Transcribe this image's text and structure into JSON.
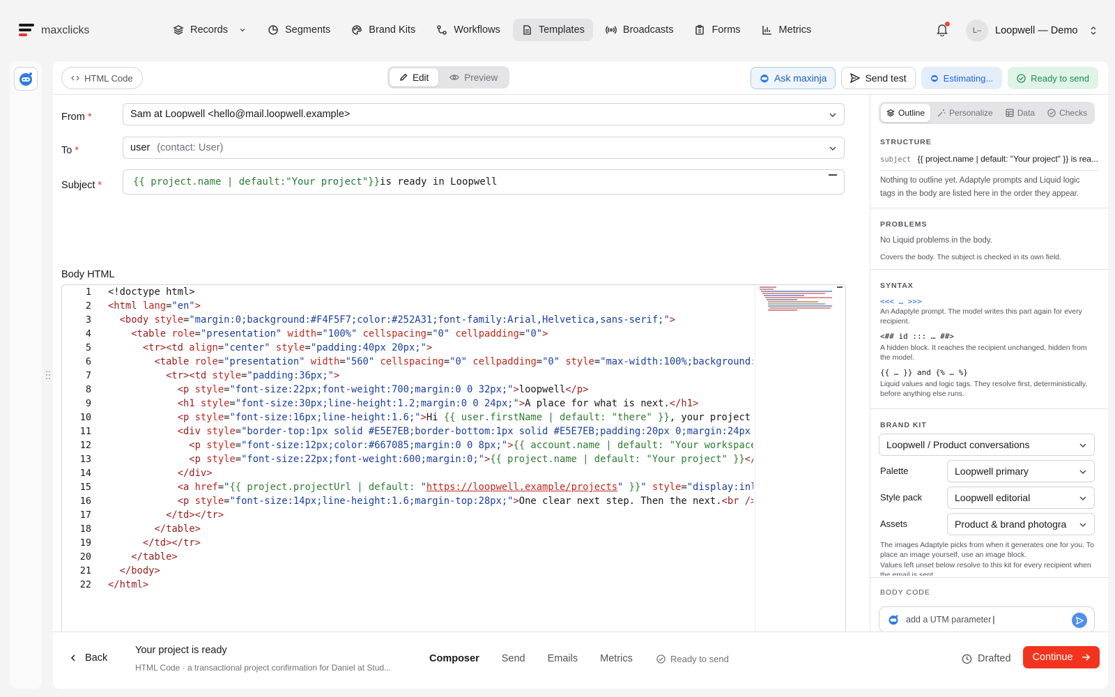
{
  "brand": {
    "name": "maxclicks",
    "accent": "#e8372a"
  },
  "nav": [
    {
      "label": "Records",
      "icon": "layers-icon",
      "dropdown": true,
      "active": false
    },
    {
      "label": "Segments",
      "icon": "pie-icon",
      "active": false
    },
    {
      "label": "Brand Kits",
      "icon": "palette-icon",
      "active": false
    },
    {
      "label": "Workflows",
      "icon": "workflow-icon",
      "active": false
    },
    {
      "label": "Templates",
      "icon": "document-icon",
      "active": true
    },
    {
      "label": "Broadcasts",
      "icon": "broadcast-icon",
      "active": false
    },
    {
      "label": "Forms",
      "icon": "clipboard-icon",
      "active": false
    },
    {
      "label": "Metrics",
      "icon": "bar-chart-icon",
      "active": false
    }
  ],
  "account": {
    "initials": "L–",
    "name": "Loopwell — Demo"
  },
  "toolbar": {
    "html_code_label": "HTML Code",
    "edit_label": "Edit",
    "preview_label": "Preview",
    "ask_label": "Ask maxinja",
    "send_test_label": "Send test",
    "estimating_label": "Estimating...",
    "ready_label": "Ready to send"
  },
  "form": {
    "from_label": "From",
    "from_value": "Sam at Loopwell <hello@mail.loopwell.example>",
    "to_label": "To",
    "to_value": "user",
    "to_hint": "(contact: User)",
    "subject_label": "Subject",
    "subject_liquid": "{{ project.name | default: ",
    "subject_string": "\"Your project\"",
    "subject_close": " }}",
    "subject_rest": " is ready in Loopwell",
    "body_label": "Body HTML"
  },
  "code_lines": [
    "1",
    "2",
    "3",
    "4",
    "5",
    "6",
    "7",
    "8",
    "9",
    "10",
    "11",
    "12",
    "13",
    "14",
    "15",
    "16",
    "17",
    "18",
    "19",
    "20",
    "21",
    "22"
  ],
  "right_panel": {
    "tabs": [
      "Outline",
      "Personalize",
      "Data",
      "Checks"
    ],
    "structure_title": "STRUCTURE",
    "structure_key": "subject",
    "structure_value": "{{ project.name | default: \"Your project\" }} is rea...",
    "structure_note": "Nothing to outline yet. Adaptyle prompts and Liquid logic tags in the body are listed here in the order they appear.",
    "problems_title": "PROBLEMS",
    "problems_text": "No Liquid problems in the body.",
    "problems_note": "Covers the body. The subject is checked in its own field.",
    "syntax_title": "SYNTAX",
    "syntax_1": "<<< … >>>",
    "syntax_1_desc": "An Adaptyle prompt. The model writes this part again for every recipient.",
    "syntax_2": "<## id ::: … ##>",
    "syntax_2_desc": "A hidden block. It reaches the recipient unchanged, hidden from the model.",
    "syntax_3": "{{ … }} and {% … %}",
    "syntax_3_desc": "Liquid values and logic tags. They resolve first, deterministically, before anything else runs.",
    "brand_title": "BRAND KIT",
    "brand_kit": "Loopwell / Product conversations",
    "palette_label": "Palette",
    "palette_value": "Loopwell primary",
    "style_label": "Style pack",
    "style_value": "Loopwell editorial",
    "assets_label": "Assets",
    "assets_value": "Product & brand photogra",
    "assets_note": "The images Adaptyle picks from when it generates one for you. To place an image yourself, use an image block.",
    "unset_note": "Values left unset below resolve to this kit for every recipient when the email is sent.",
    "body_code_title": "BODY CODE",
    "chat_value": "add a UTM parameter"
  },
  "bottom": {
    "back_label": "Back",
    "title": "Your project is ready",
    "subtitle": "HTML Code · a transactional project confirmation for Daniel at Stud...",
    "tabs": [
      "Composer",
      "Send",
      "Emails",
      "Metrics"
    ],
    "status": "Ready to send",
    "drafted_label": "Drafted",
    "continue_label": "Continue"
  }
}
